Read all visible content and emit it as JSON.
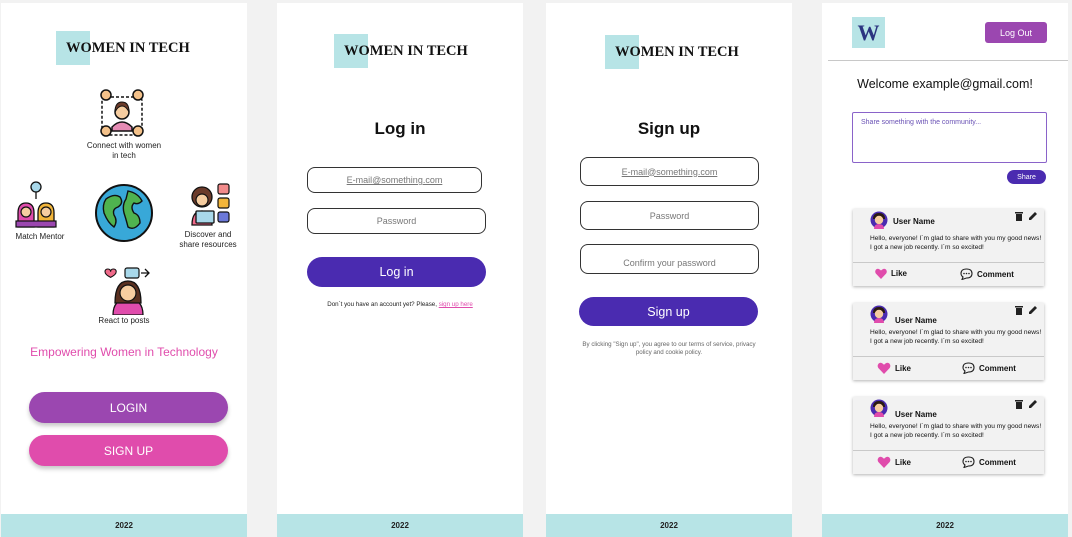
{
  "brand": {
    "name": "WOMEN IN TECH",
    "monogram": "W",
    "accent": "#b7e4e6",
    "purple": "#4a2bb0",
    "pink": "#e04cac",
    "violet": "#9b47b0"
  },
  "footer": {
    "year": "2022"
  },
  "landing": {
    "features": {
      "connect": "Connect with women in tech",
      "mentor": "Match Mentor",
      "discover": "Discover and share resources",
      "react": "React to posts"
    },
    "tagline": "Empowering Women in Technology",
    "login_label": "LOGIN",
    "signup_label": "SIGN UP"
  },
  "login": {
    "title": "Log in",
    "email_placeholder": "E-mail@something.com",
    "password_placeholder": "Password",
    "button": "Log in",
    "no_account_text": "Don´t you have an account yet? Please,",
    "signup_link": "sign up here"
  },
  "signup": {
    "title": "Sign up",
    "email_placeholder": "E-mail@something.com",
    "password_placeholder": "Password",
    "confirm_placeholder": "Confirm your password",
    "button": "Sign up",
    "terms": "By clicking \"Sign up\", you agree to our terms of service, privacy policy and cookie policy."
  },
  "feed": {
    "logout_label": "Log Out",
    "welcome": "Welcome example@gmail.com!",
    "share_placeholder": "Share something with the community...",
    "share_label": "Share",
    "posts": [
      {
        "user": "User Name",
        "text": "Hello, everyone! I´m glad to share with you my good news! I got a new job recently. I´m so excited!",
        "like": "Like",
        "comment": "Comment"
      },
      {
        "user": "User Name",
        "text": "Hello, everyone! I´m glad to share with you my good news! I got a new job recently. I´m so excited!",
        "like": "Like",
        "comment": "Comment"
      },
      {
        "user": "User Name",
        "text": "Hello, everyone! I´m glad to share with you my good news! I got a new job recently. I´m so excited!",
        "like": "Like",
        "comment": "Comment"
      }
    ]
  }
}
